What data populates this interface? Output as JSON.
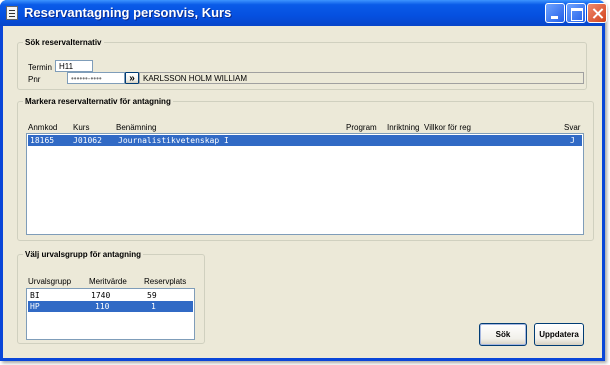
{
  "window": {
    "title": "Reservantagning personvis, Kurs"
  },
  "search": {
    "legend": "Sök reservalternativ",
    "termin_label": "Termin",
    "termin_value": "H11",
    "pnr_label": "Pnr",
    "pnr_value": "••••••-••••",
    "go_label": "»",
    "name": "KARLSSON HOLM WILLIAM"
  },
  "markera": {
    "legend": "Markera reservalternativ för antagning",
    "columns": [
      "Anmkod",
      "Kurs",
      "Benämning",
      "Program",
      "Inriktning",
      "Villkor för reg",
      "Svar"
    ],
    "rows": [
      {
        "anmkod": "18165",
        "kurs": "J01062",
        "benamning": "Journalistikvetenskap I",
        "program": "",
        "inriktning": "",
        "villkor": "",
        "svar": "J",
        "selected": true
      }
    ]
  },
  "urval": {
    "legend": "Välj urvalsgrupp för antagning",
    "columns": [
      "Urvalsgrupp",
      "Meritvärde",
      "Reservplats"
    ],
    "rows": [
      {
        "grupp": "BI",
        "merit": "1740",
        "reserv": "59",
        "selected": false
      },
      {
        "grupp": "HP",
        "merit": "110",
        "reserv": "1",
        "selected": true
      }
    ]
  },
  "buttons": {
    "sok": "Sök",
    "uppdatera": "Uppdatera"
  },
  "colors": {
    "titlebar": "#0550e0",
    "selection": "#316ac5",
    "dialog": "#ece9d8"
  }
}
